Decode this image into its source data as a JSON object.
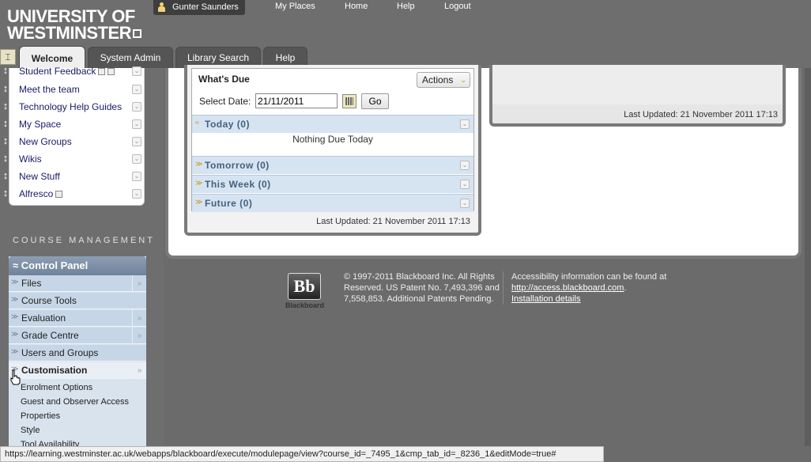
{
  "logo": {
    "line1": "UNIVERSITY OF",
    "line2": "WESTMINSTER"
  },
  "top_nav": {
    "user": "Gunter Saunders",
    "links": [
      "My Places",
      "Home",
      "Help",
      "Logout"
    ]
  },
  "tabs": [
    {
      "label": "Welcome",
      "active": true
    },
    {
      "label": "System Admin",
      "active": false
    },
    {
      "label": "Library Search",
      "active": false
    },
    {
      "label": "Help",
      "active": false
    }
  ],
  "tools": [
    "Student Feedback",
    "Meet the team",
    "Technology Help Guides",
    "My Space",
    "New Groups",
    "Wikis",
    "New Stuff",
    "Alfresco"
  ],
  "course_management": {
    "title": "COURSE MANAGEMENT",
    "control_panel": "Control Panel",
    "items": [
      "Files",
      "Course Tools",
      "Evaluation",
      "Grade Centre",
      "Users and Groups",
      "Customisation"
    ],
    "sub_items": [
      "Enrolment Options",
      "Guest and Observer Access",
      "Properties",
      "Style",
      "Tool Availability"
    ]
  },
  "whats_due": {
    "title": "What's Due",
    "actions_label": "Actions",
    "select_date_label": "Select Date:",
    "date_value": "21/11/2011",
    "go_label": "Go",
    "today": "Today (0)",
    "nothing_due": "Nothing Due Today",
    "tomorrow": "Tomorrow (0)",
    "this_week": "This Week (0)",
    "future": "Future (0)",
    "last_updated": "Last Updated: 21 November 2011 17:13"
  },
  "right_module": {
    "last_updated": "Last Updated: 21 November 2011 17:13"
  },
  "footer": {
    "bb_mark": "Bb",
    "bb_text": "Blackboard",
    "copyright": "© 1997-2011 Blackboard Inc. All Rights Reserved. US Patent No. 7,493,396 and 7,558,853. Additional Patents Pending.",
    "access_text": "Accessibility information can be found at",
    "access_link": "http://access.blackboard.com",
    "access_period": ".",
    "install_link": "Installation details"
  },
  "status_bar": "https://learning.westminster.ac.uk/webapps/blackboard/execute/modulepage/view?course_id=_7495_1&cmp_tab_id=_8236_1&editMode=true#"
}
